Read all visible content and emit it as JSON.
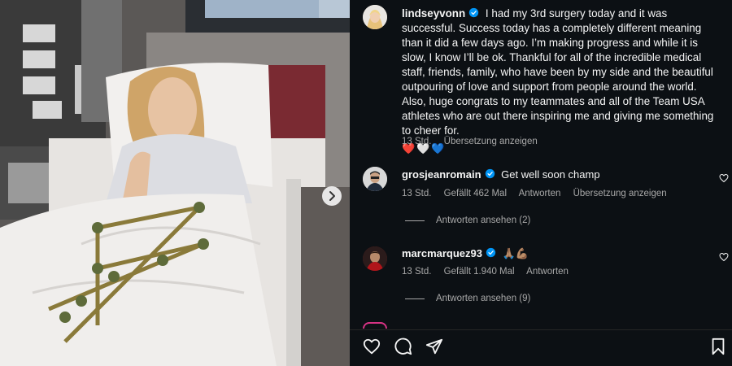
{
  "post": {
    "author": "lindseyvonn",
    "caption": "I had my 3rd surgery today and it was successful. Success today has a completely different meaning than it did a few days ago. I’m making progress and while it is slow, I know I’ll be ok. Thankful for all of the incredible medical staff, friends, family, who have been by my side and the beautiful outpouring of love and support from people around the world. Also, huge congrats to my teammates and all of the Team USA athletes who are out there inspiring me and giving me something to cheer for.",
    "emojis": "❤️🤍💙",
    "time": "13 Std.",
    "translate": "Übersetzung anzeigen"
  },
  "comments": [
    {
      "author": "grosjeanromain",
      "text": "Get well soon champ",
      "time": "13 Std.",
      "likes": "Gefällt 462 Mal",
      "reply": "Antworten",
      "translate": "Übersetzung anzeigen",
      "view_replies": "Antworten ansehen (2)"
    },
    {
      "author": "marcmarquez93",
      "text": "🙏🏽💪🏽",
      "time": "13 Std.",
      "likes": "Gefällt 1.940 Mal",
      "reply": "Antworten",
      "view_replies": "Antworten ansehen (9)"
    }
  ],
  "icons": {
    "like": "heart-icon",
    "comment": "comment-icon",
    "share": "share-icon",
    "save": "bookmark-icon",
    "next": "chevron-right-icon",
    "verified": "verified-badge-icon"
  },
  "colors": {
    "panel_bg": "#0c1014",
    "text": "#f5f5f5",
    "muted": "#a8a8a8",
    "verified": "#0095f6"
  }
}
